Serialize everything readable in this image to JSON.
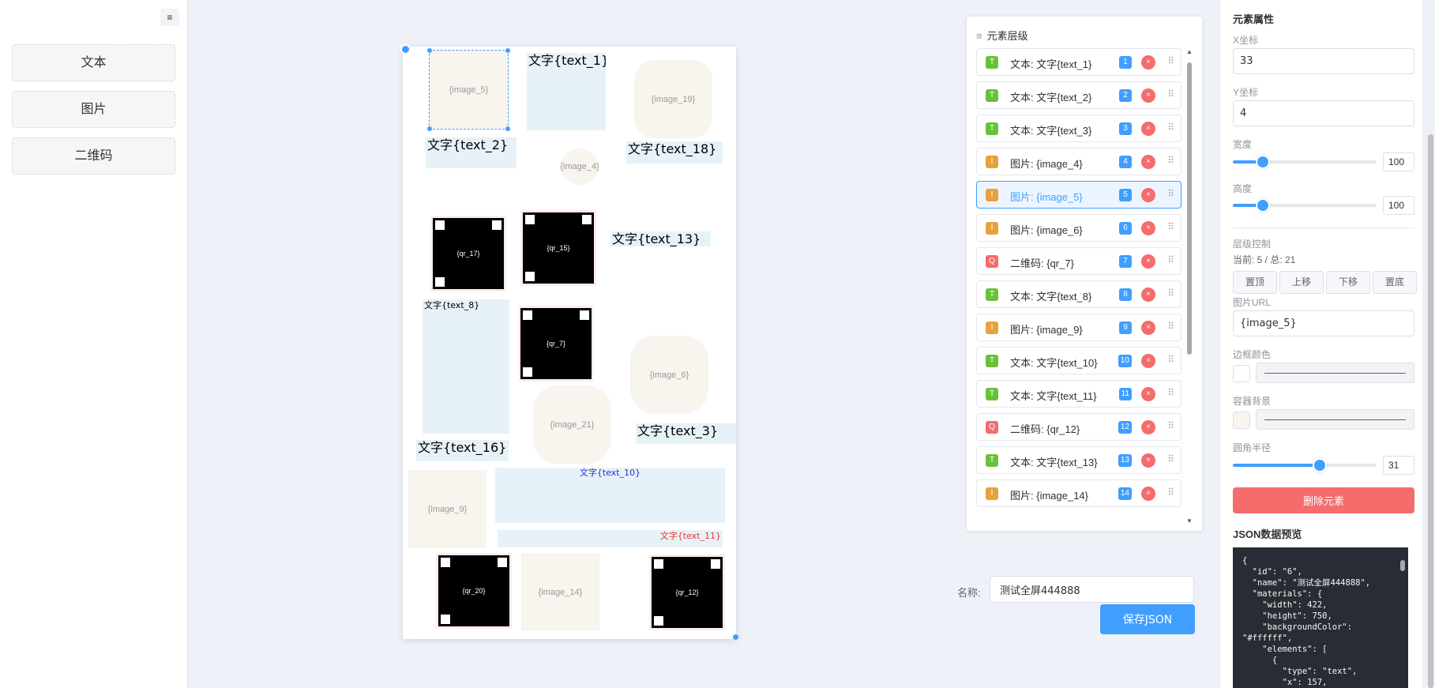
{
  "toolbar": {
    "menu_icon": "≡",
    "items": [
      {
        "label": "文本"
      },
      {
        "label": "图片"
      },
      {
        "label": "二维码"
      }
    ]
  },
  "canvas": {
    "background_color": "#ffffff",
    "texts": [
      {
        "id": "text_1",
        "label": "文字{text_1}"
      },
      {
        "id": "text_2",
        "label": "文字{text_2}"
      },
      {
        "id": "text_18",
        "label": "文字{text_18}"
      },
      {
        "id": "text_13",
        "label": "文字{text_13}"
      },
      {
        "id": "text_8",
        "label": "文字{text_8}"
      },
      {
        "id": "text_3",
        "label": "文字{text_3}"
      },
      {
        "id": "text_16",
        "label": "文字{text_16}"
      },
      {
        "id": "text_10",
        "label": "文字{text_10}"
      },
      {
        "id": "text_11",
        "label": "文字{text_11}"
      }
    ],
    "images": [
      {
        "id": "image_5",
        "label": "{image_5}"
      },
      {
        "id": "image_19",
        "label": "{image_19}"
      },
      {
        "id": "image_4",
        "label": "{image_4}"
      },
      {
        "id": "image_6",
        "label": "{image_6}"
      },
      {
        "id": "image_21",
        "label": "{image_21}"
      },
      {
        "id": "image_9",
        "label": "{image_9}"
      },
      {
        "id": "image_14",
        "label": "{image_14}"
      }
    ],
    "qrs": [
      {
        "id": "qr_17",
        "label": "{qr_17}"
      },
      {
        "id": "qr_15",
        "label": "{qr_15}"
      },
      {
        "id": "qr_7",
        "label": "{qr_7}"
      },
      {
        "id": "qr_20",
        "label": "{qr_20}"
      },
      {
        "id": "qr_12",
        "label": "{qr_12}"
      }
    ],
    "text_10_color": "#2b2bd1",
    "text_11_color": "#e53935"
  },
  "layers": {
    "title_icon": "≡",
    "title": "元素层级",
    "items": [
      {
        "type": "T",
        "label": "文本: 文字{text_1}",
        "index": "1"
      },
      {
        "type": "T",
        "label": "文本: 文字{text_2}",
        "index": "2"
      },
      {
        "type": "T",
        "label": "文本: 文字{text_3}",
        "index": "3"
      },
      {
        "type": "I",
        "label": "图片: {image_4}",
        "index": "4"
      },
      {
        "type": "I",
        "label": "图片: {image_5}",
        "index": "5",
        "active": true
      },
      {
        "type": "I",
        "label": "图片: {image_6}",
        "index": "6"
      },
      {
        "type": "Q",
        "label": "二维码: {qr_7}",
        "index": "7"
      },
      {
        "type": "T",
        "label": "文本: 文字{text_8}",
        "index": "8"
      },
      {
        "type": "I",
        "label": "图片: {image_9}",
        "index": "9"
      },
      {
        "type": "T",
        "label": "文本: 文字{text_10}",
        "index": "10"
      },
      {
        "type": "T",
        "label": "文本: 文字{text_11}",
        "index": "11"
      },
      {
        "type": "Q",
        "label": "二维码: {qr_12}",
        "index": "12"
      },
      {
        "type": "T",
        "label": "文本: 文字{text_13}",
        "index": "13"
      },
      {
        "type": "I",
        "label": "图片: {image_14}",
        "index": "14"
      }
    ],
    "delete_glyph": "×",
    "drag_glyph": "⠿"
  },
  "save": {
    "name_label": "名称:",
    "name_value": "测试全屏444888",
    "save_label": "保存JSON"
  },
  "properties": {
    "title": "元素属性",
    "x_label": "X坐标",
    "x_value": "33",
    "y_label": "Y坐标",
    "y_value": "4",
    "width_label": "宽度",
    "width_value": "100",
    "height_label": "高度",
    "height_value": "100",
    "level_label": "层级控制",
    "level_status": "当前: 5 / 总: 21",
    "level_buttons": [
      "置顶",
      "上移",
      "下移",
      "置底"
    ],
    "image_url_label": "图片URL",
    "image_url_value": "{image_5}",
    "border_color_label": "边框颜色",
    "border_color": "#ffffff",
    "container_bg_label": "容器背景",
    "container_bg": "#f8f4ee",
    "radius_label": "圆角半径",
    "radius_value": "31",
    "delete_label": "删除元素",
    "json_title": "JSON数据预览",
    "json_text": "{\n  \"id\": \"6\",\n  \"name\": \"测试全屏444888\",\n  \"materials\": {\n    \"width\": 422,\n    \"height\": 750,\n    \"backgroundColor\":\n\"#ffffff\",\n    \"elements\": [\n      {\n        \"type\": \"text\",\n        \"x\": 157,"
  }
}
